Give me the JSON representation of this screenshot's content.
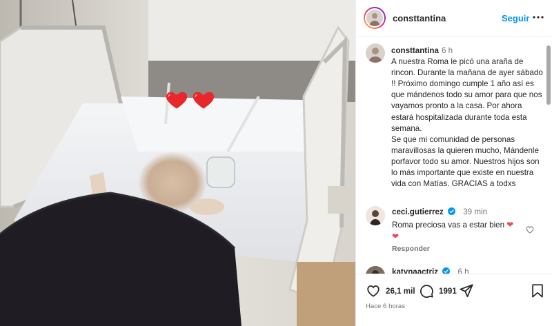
{
  "post": {
    "username": "consttantina",
    "follow_label": "Seguir"
  },
  "caption": {
    "username": "consttantina",
    "time": "6 h",
    "paragraph1": "A nuestra Roma le picó una araña de rincon. Durante la mañana de ayer sábado !! Próximo domingo cumple 1 año así es que mándenos todo su amor para que nos vayamos pronto a la casa. Por ahora estará  hospitalizada durante toda esta semana.",
    "paragraph2": "Se que mi comunidad de personas maravillosas la quieren mucho, Mándenle porfavor todo su amor. Nuestros hijos son lo más importante que existe en nuestra vida con Matías. GRACIAS a todxs"
  },
  "comments": [
    {
      "username": "ceci.gutierrez",
      "time": "39 min",
      "text": "Roma preciosa vas a estar bien",
      "reply_label": "Responder"
    },
    {
      "username": "katynaactriz",
      "time": "6 h"
    }
  ],
  "actions": {
    "likes": "26,1 mil",
    "comments": "1991",
    "posted_ago": "Hace 6 horas"
  },
  "photo": {
    "overlay_stickers": [
      "red-heart",
      "red-heart"
    ]
  },
  "colors": {
    "link_blue": "#0095f6",
    "heart_red": "#ed4956",
    "muted_text": "#737373",
    "verified_blue": "#0095f6"
  },
  "icons": [
    "more-options-icon",
    "heart-icon",
    "comment-icon",
    "share-icon",
    "bookmark-icon",
    "verified-badge-icon",
    "like-comment-icon"
  ]
}
